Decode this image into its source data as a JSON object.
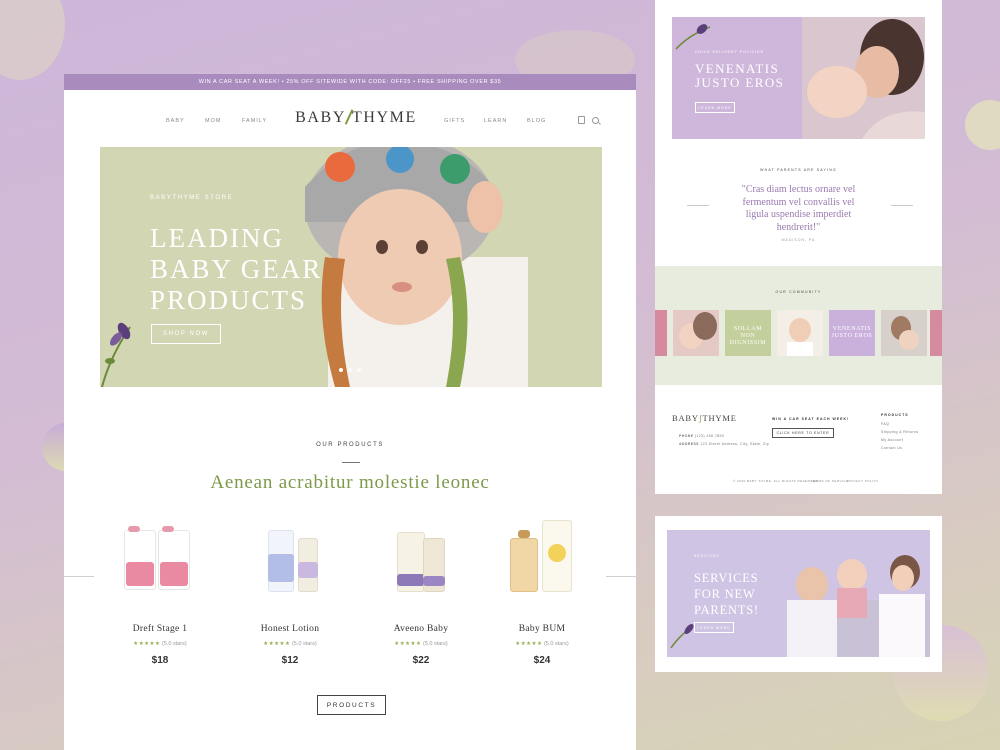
{
  "promo_bar": {
    "text": "WIN A CAR SEAT A WEEK! • 25% OFF SITEWIDE WITH CODE: OFF25 • FREE SHIPPING OVER $35"
  },
  "nav": {
    "left": [
      "BABY",
      "MOM",
      "FAMILY"
    ],
    "logo": {
      "left": "BABY",
      "right": "THYME"
    },
    "right": [
      "GIFTS",
      "LEARN",
      "BLOG"
    ]
  },
  "hero": {
    "eyebrow": "BABYTHYME STORE",
    "title": "LEADING BABY GEAR PRODUCTS",
    "button": "SHOP NOW"
  },
  "products_section": {
    "label": "OUR PRODUCTS",
    "title": "Aenean acrabitur molestie leonec",
    "items": [
      {
        "name": "Dreft Stage 1",
        "rating": "(5.0 stars)",
        "price": "$18"
      },
      {
        "name": "Honest Lotion",
        "rating": "(5.0 stars)",
        "price": "$12"
      },
      {
        "name": "Aveeno Baby",
        "rating": "(5.0 stars)",
        "price": "$22"
      },
      {
        "name": "Baby BUM",
        "rating": "(5.0 stars)",
        "price": "$24"
      }
    ],
    "button": "PRODUCTS"
  },
  "panel_banner": {
    "eyebrow": "CHILD DELIVERY POLICIES",
    "title": "VENENATIS JUSTO EROS",
    "button": "LEARN MORE"
  },
  "testimonial": {
    "label": "WHAT PARENTS ARE SAYING",
    "quote": "\"Cras diam lectus ornare vel fermentum vel convallis vel ligula uspendise imperdiet hendrerit!\"",
    "author": "MADISON, PA"
  },
  "community": {
    "label": "OUR COMMUNITY",
    "tiles": [
      "SOLLAM NON DIGNISSIM",
      "VENENATIS JUSTO EROS"
    ]
  },
  "footer": {
    "logo": {
      "left": "BABY",
      "right": "THYME"
    },
    "phone_label": "PHONE",
    "phone": "(123) 456 7890",
    "address_label": "ADDRESS",
    "address": "123 Street Address, City, State, Zip",
    "promo_title": "WIN A CAR SEAT EACH WEEK!",
    "promo_button": "CLICK HERE TO ENTER",
    "links_title": "PRODUCTS",
    "links": [
      "FAQ",
      "Shipping & Returns",
      "My Account",
      "Contact Us"
    ],
    "copyright": "© 2020 BABY THYME. ALL RIGHTS RESERVED.",
    "terms": "TERMS OF SERVICE",
    "privacy": "PRIVACY POLICY"
  },
  "services_banner": {
    "eyebrow": "SERVICES",
    "title": "SERVICES FOR NEW PARENTS!",
    "button": "LEARN MORE"
  },
  "colors": {
    "background": "#cdb6d9",
    "promo": "#a98bbd",
    "hero": "#d2d6b2",
    "accent_green": "#7c9a4a",
    "accent_purple": "#9a7ab0",
    "community_pink": "#d58aa0"
  }
}
